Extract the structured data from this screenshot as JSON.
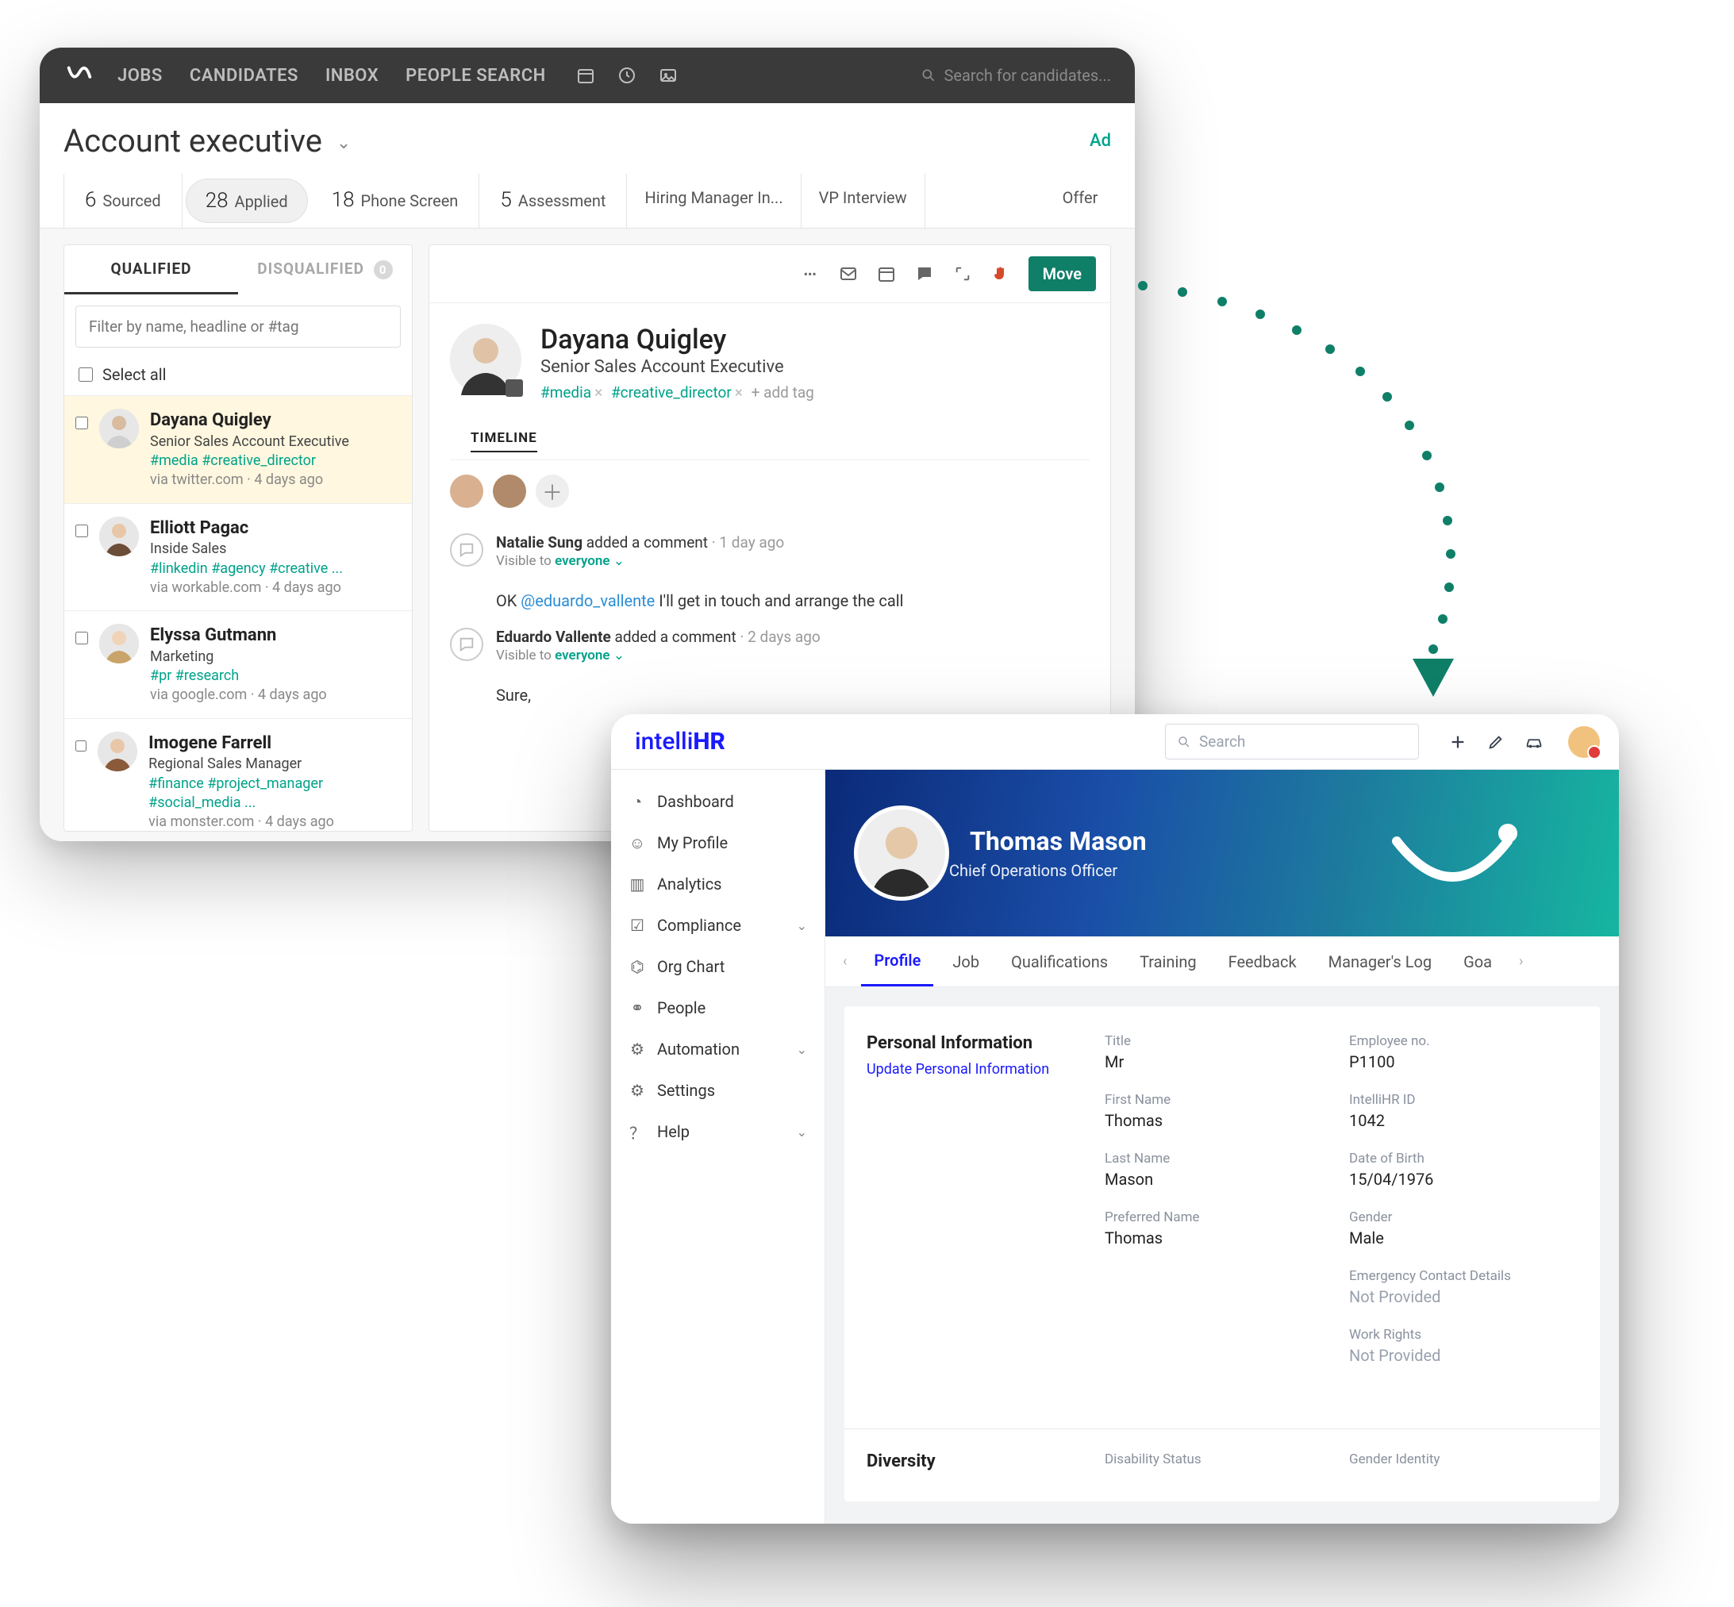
{
  "workable": {
    "nav": {
      "jobs": "JOBS",
      "candidates": "CANDIDATES",
      "inbox": "INBOX",
      "people_search": "PEOPLE SEARCH"
    },
    "search_placeholder": "Search for candidates...",
    "job_title": "Account executive",
    "add_label": "Ad",
    "stages": [
      {
        "count": "6",
        "label": "Sourced"
      },
      {
        "count": "28",
        "label": "Applied"
      },
      {
        "count": "18",
        "label": "Phone Screen"
      },
      {
        "count": "5",
        "label": "Assessment"
      },
      {
        "count": "",
        "label": "Hiring Manager In..."
      },
      {
        "count": "",
        "label": "VP Interview"
      },
      {
        "count": "",
        "label": "Offer"
      }
    ],
    "tabs": {
      "qualified": "QUALIFIED",
      "disqualified": "DISQUALIFIED",
      "dq_count": "0"
    },
    "filter_placeholder": "Filter by name, headline or #tag",
    "select_all": "Select all",
    "candidates": [
      {
        "name": "Dayana Quigley",
        "title": "Senior Sales Account Executive",
        "tags": "#media #creative_director",
        "meta": "via twitter.com · 4 days ago"
      },
      {
        "name": "Elliott Pagac",
        "title": "Inside Sales",
        "tags": "#linkedin #agency #creative ...",
        "meta": "via workable.com · 4 days ago"
      },
      {
        "name": "Elyssa Gutmann",
        "title": "Marketing",
        "tags": "#pr #research",
        "meta": "via google.com · 4 days ago"
      },
      {
        "name": "Imogene Farrell",
        "title": "Regional Sales Manager",
        "tags": "#finance #project_manager #social_media ...",
        "meta": "via monster.com · 4 days ago"
      }
    ],
    "profile": {
      "name": "Dayana Quigley",
      "title": "Senior Sales Account Executive",
      "tag1": "#media",
      "tag2": "#creative_director",
      "add_tag": "+ add tag",
      "timeline_label": "TIMELINE",
      "move_label": "Move"
    },
    "comments": [
      {
        "author": "Natalie Sung",
        "verb": "added a comment",
        "when": "1 day ago",
        "vis_prefix": "Visible to ",
        "vis_value": "everyone",
        "text_before": "OK ",
        "mention": "@eduardo_vallente",
        "text_after": " I'll get in touch and arrange the call"
      },
      {
        "author": "Eduardo Vallente",
        "verb": "added a comment",
        "when": "2 days ago",
        "vis_prefix": "Visible to ",
        "vis_value": "everyone",
        "reply_prefix": "Sure, "
      }
    ]
  },
  "intelli": {
    "logo_a": "intelli",
    "logo_b": "HR",
    "search_placeholder": "Search",
    "sidebar": [
      {
        "label": "Dashboard",
        "chev": false
      },
      {
        "label": "My Profile",
        "chev": false
      },
      {
        "label": "Analytics",
        "chev": false
      },
      {
        "label": "Compliance",
        "chev": true
      },
      {
        "label": "Org Chart",
        "chev": false
      },
      {
        "label": "People",
        "chev": false
      },
      {
        "label": "Automation",
        "chev": true
      },
      {
        "label": "Settings",
        "chev": false
      },
      {
        "label": "Help",
        "chev": true
      }
    ],
    "hero": {
      "name": "Thomas Mason",
      "title": "Chief Operations Officer"
    },
    "tabs": [
      "Profile",
      "Job",
      "Qualifications",
      "Training",
      "Feedback",
      "Manager's Log",
      "Goa"
    ],
    "personal": {
      "section": "Personal Information",
      "update": "Update Personal Information",
      "left": [
        {
          "label": "Title",
          "value": "Mr"
        },
        {
          "label": "First Name",
          "value": "Thomas"
        },
        {
          "label": "Last Name",
          "value": "Mason"
        },
        {
          "label": "Preferred Name",
          "value": "Thomas"
        }
      ],
      "right": [
        {
          "label": "Employee no.",
          "value": "P1100"
        },
        {
          "label": "IntelliHR ID",
          "value": "1042"
        },
        {
          "label": "Date of Birth",
          "value": "15/04/1976"
        },
        {
          "label": "Gender",
          "value": "Male"
        },
        {
          "label": "Emergency Contact Details",
          "value": "Not Provided",
          "muted": true
        },
        {
          "label": "Work Rights",
          "value": "Not Provided",
          "muted": true
        }
      ]
    },
    "diversity": {
      "section": "Diversity",
      "col1": "Disability Status",
      "col2": "Gender Identity"
    }
  }
}
